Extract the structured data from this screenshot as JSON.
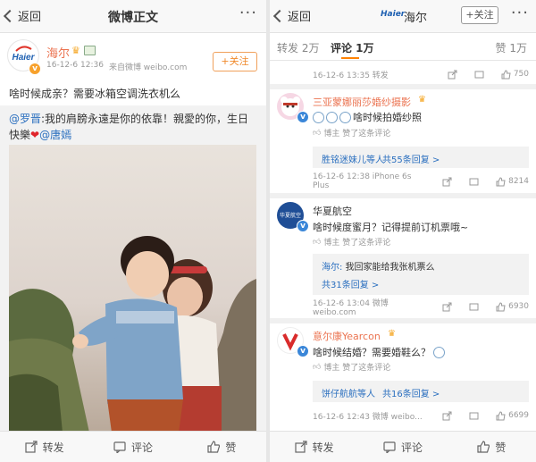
{
  "left": {
    "nav": {
      "back_label": "返回",
      "title": "微博正文",
      "more": "···"
    },
    "post": {
      "logo_text": "Haier",
      "author": "海尔",
      "follow_label": "+关注",
      "date": "16-12-6 12:36",
      "source": "来自微博 weibo.com",
      "text": "啥时候成亲？需要冰箱空调洗衣机么",
      "repost_mention": "@罗晋",
      "repost_text": ":我的肩膀永遠是你的依靠！親愛的你，生日快樂",
      "repost_mention2": "@唐嫣"
    },
    "bottom": {
      "repost": "转发",
      "comment": "评论",
      "like": "赞"
    }
  },
  "right": {
    "nav": {
      "back_label": "返回",
      "title": "海尔",
      "follow_label": "+关注",
      "more": "···",
      "logo_text": "Haier"
    },
    "tabs": {
      "repost": "转发 2万",
      "comment": "评论 1万",
      "like": "赞 1万"
    },
    "top_stats": {
      "time": "16-12-6 13:35 转发",
      "likes": "750"
    },
    "comments": [
      {
        "name": "三亚蒙娜丽莎婚纱摄影",
        "text": "啥时候拍婚纱照",
        "author_like": "博主 赞了这条评论",
        "reply_summary": "胜铭迷妹儿等人",
        "reply_count": "共55条回复 >",
        "time": "16-12-6 12:38 iPhone 6s Plus",
        "likes": "8214"
      },
      {
        "name": "华夏航空",
        "avatar_text": "华夏航空",
        "text": "啥时候度蜜月？记得提前订机票哦~",
        "author_like": "博主 赞了这条评论",
        "reply_author": "海尔:",
        "reply_text": " 我回家能给我张机票么",
        "reply_count": "共31条回复 >",
        "time": "16-12-6 13:04 微博 weibo.com",
        "likes": "6930"
      },
      {
        "name": "意尔康Yearcon",
        "text": "啥时候结婚？需要婚鞋么？",
        "author_like": "博主 赞了这条评论",
        "reply_summary": "饼仔航航等人",
        "reply_count": "共16条回复 >",
        "time": "16-12-6 12:43 微博 weibo...",
        "likes": "6699"
      }
    ],
    "bottom": {
      "repost": "转发",
      "comment": "评论",
      "like": "赞"
    }
  },
  "colors": {
    "accent_orange": "#eb7350",
    "link_blue": "#2a6fbf",
    "haier_blue": "#1d5fb1"
  }
}
